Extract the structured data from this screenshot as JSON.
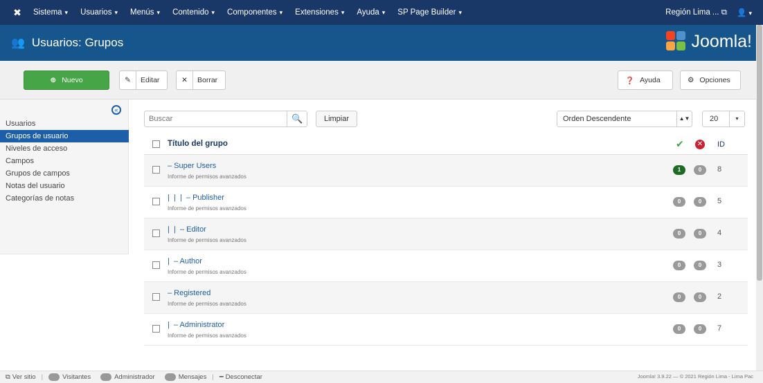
{
  "navbar": {
    "logo_icon": "joomla-x-icon",
    "menu": [
      {
        "label": "Sistema"
      },
      {
        "label": "Usuarios"
      },
      {
        "label": "Menús"
      },
      {
        "label": "Contenido"
      },
      {
        "label": "Componentes"
      },
      {
        "label": "Extensiones"
      },
      {
        "label": "Ayuda"
      },
      {
        "label": "SP Page Builder"
      }
    ],
    "site_link": "Región Lima ...",
    "external_icon": "external-link-icon",
    "user_icon": "user-icon"
  },
  "subhead": {
    "title": "Usuarios: Grupos",
    "brand": "Joomla!"
  },
  "toolbar": {
    "new_label": "Nuevo",
    "edit_label": "Editar",
    "delete_label": "Borrar",
    "help_label": "Ayuda",
    "options_label": "Opciones"
  },
  "sidebar": {
    "items": [
      {
        "label": "Usuarios",
        "active": false
      },
      {
        "label": "Grupos de usuario",
        "active": true
      },
      {
        "label": "Niveles de acceso",
        "active": false
      },
      {
        "label": "Campos",
        "active": false
      },
      {
        "label": "Grupos de campos",
        "active": false
      },
      {
        "label": "Notas del usuario",
        "active": false
      },
      {
        "label": "Categorías de notas",
        "active": false
      }
    ]
  },
  "filters": {
    "search_placeholder": "Buscar",
    "clear_label": "Limpiar",
    "order_value": "Orden  Descendente",
    "limit_value": "20"
  },
  "table": {
    "header_title": "Título del grupo",
    "header_id": "ID",
    "rows": [
      {
        "name": "– Super Users",
        "indent": 0,
        "perm": "Informe de permisos avanzados",
        "active_users": "1",
        "blocked_users": "0",
        "id": "8"
      },
      {
        "name": "|  |  |  – Publisher",
        "indent": 3,
        "perm": "Informe de permisos avanzados",
        "active_users": "0",
        "blocked_users": "0",
        "id": "5"
      },
      {
        "name": "|  |  – Editor",
        "indent": 2,
        "perm": "Informe de permisos avanzados",
        "active_users": "0",
        "blocked_users": "0",
        "id": "4"
      },
      {
        "name": "|  – Author",
        "indent": 1,
        "perm": "Informe de permisos avanzados",
        "active_users": "0",
        "blocked_users": "0",
        "id": "3"
      },
      {
        "name": "– Registered",
        "indent": 0,
        "perm": "Informe de permisos avanzados",
        "active_users": "0",
        "blocked_users": "0",
        "id": "2"
      },
      {
        "name": "|  – Administrator",
        "indent": 1,
        "perm": "Informe de permisos avanzados",
        "active_users": "0",
        "blocked_users": "0",
        "id": "7"
      }
    ]
  },
  "statusbar": {
    "view_site": "Ver sitio",
    "visitors": "Visitantes",
    "admin": "Administrador",
    "messages": "Mensajes",
    "logout": "Desconectar",
    "footer": "Joomla! 3.9.22 — © 2021 Región Lima - Lima Pac"
  },
  "colors": {
    "navbar": "#1a3867",
    "subhead": "#17568c",
    "new_button": "#46a546",
    "active_item": "#1c5fa8"
  }
}
